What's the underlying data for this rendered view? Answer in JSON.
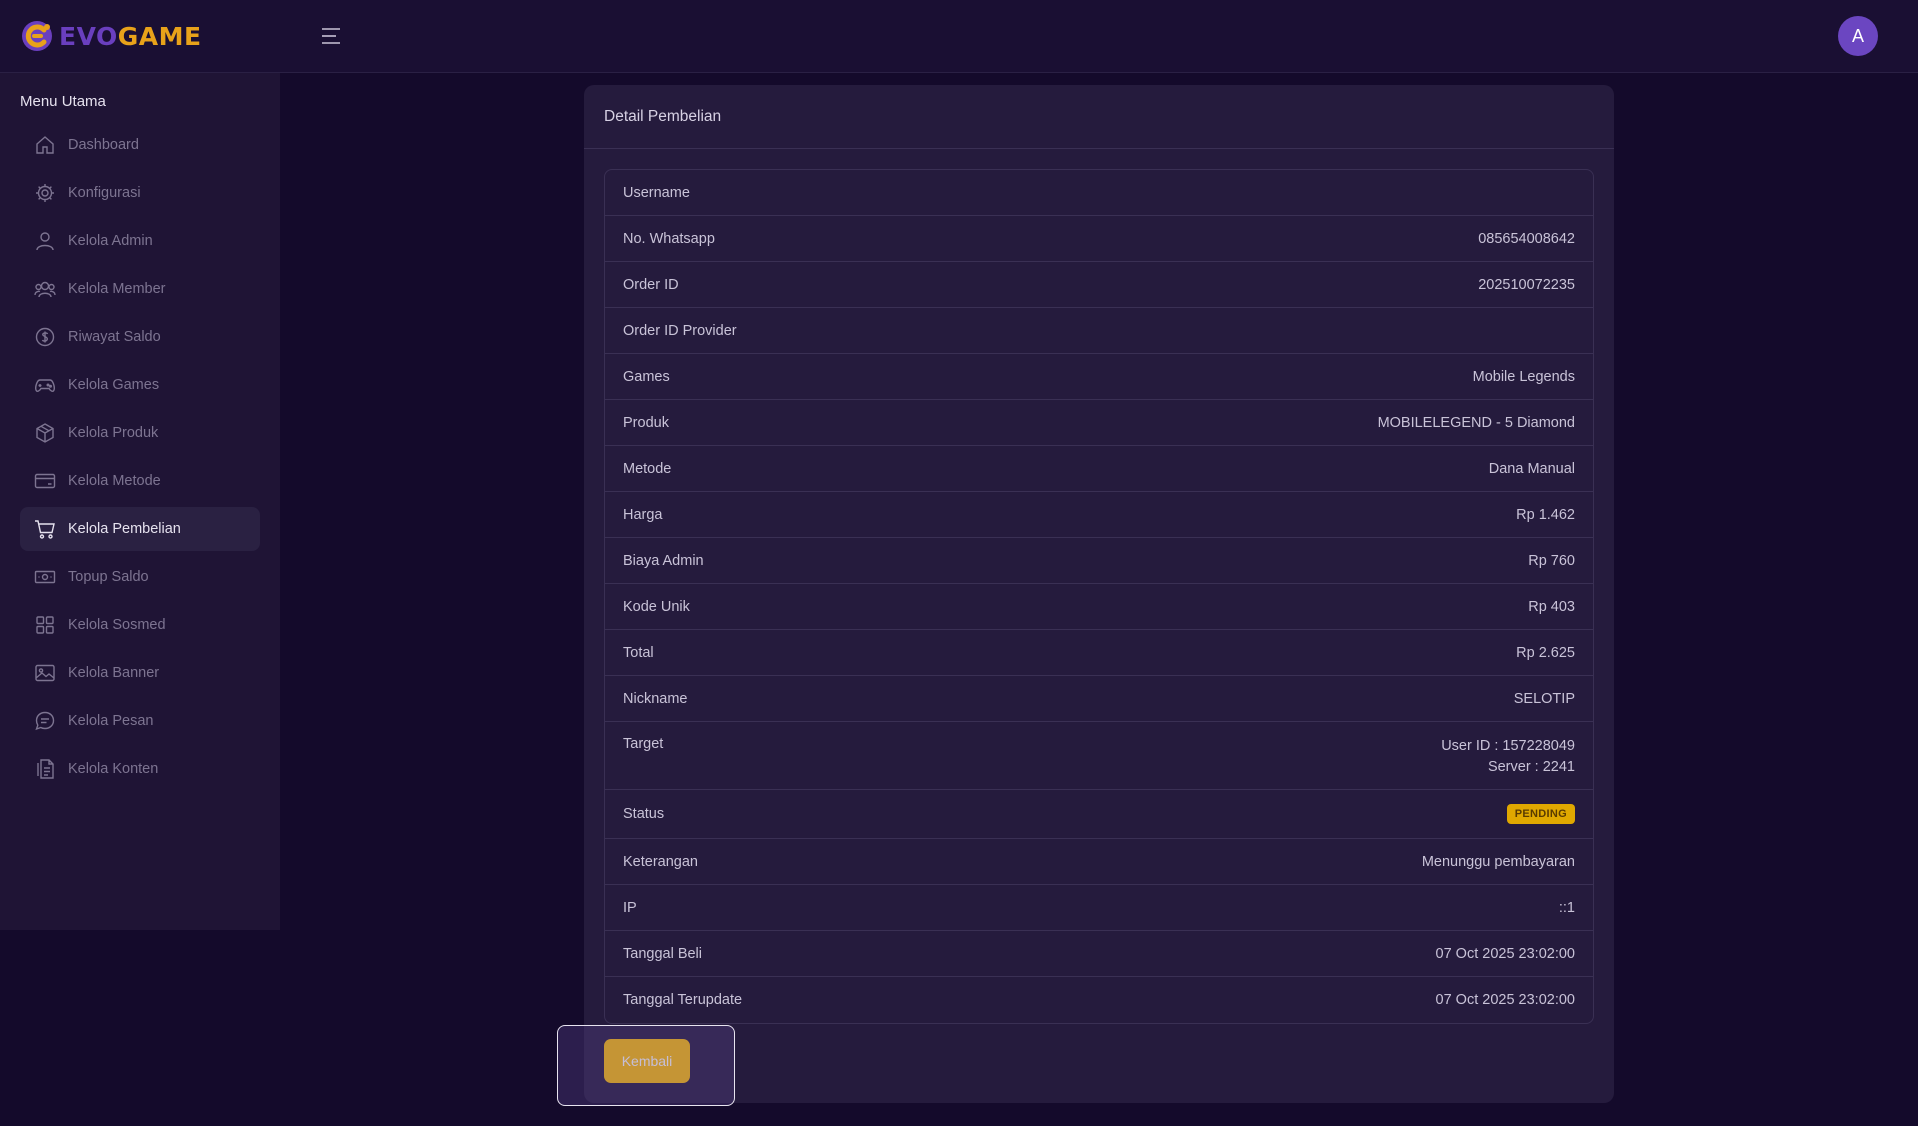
{
  "header": {
    "brand_part1": "EVO",
    "brand_part2": "GAME",
    "avatar_initial": "A",
    "colors": {
      "brand_purple": "#6a3fbf",
      "brand_orange": "#e8a21a",
      "avatar": "#6b46c1"
    }
  },
  "sidebar": {
    "heading": "Menu Utama",
    "items": [
      {
        "label": "Dashboard",
        "icon": "home-icon"
      },
      {
        "label": "Konfigurasi",
        "icon": "gear-icon"
      },
      {
        "label": "Kelola Admin",
        "icon": "user-icon"
      },
      {
        "label": "Kelola Member",
        "icon": "users-icon"
      },
      {
        "label": "Riwayat Saldo",
        "icon": "dollar-circle-icon"
      },
      {
        "label": "Kelola Games",
        "icon": "gamepad-icon"
      },
      {
        "label": "Kelola Produk",
        "icon": "box-icon"
      },
      {
        "label": "Kelola Metode",
        "icon": "credit-card-icon"
      },
      {
        "label": "Kelola Pembelian",
        "icon": "cart-icon",
        "active": true
      },
      {
        "label": "Topup Saldo",
        "icon": "cash-icon"
      },
      {
        "label": "Kelola Sosmed",
        "icon": "grid-icon"
      },
      {
        "label": "Kelola Banner",
        "icon": "image-icon"
      },
      {
        "label": "Kelola Pesan",
        "icon": "chat-icon"
      },
      {
        "label": "Kelola Konten",
        "icon": "document-icon"
      }
    ]
  },
  "card": {
    "title": "Detail Pembelian",
    "rows": [
      {
        "key": "Username",
        "value": ""
      },
      {
        "key": "No. Whatsapp",
        "value": "085654008642"
      },
      {
        "key": "Order ID",
        "value": "202510072235"
      },
      {
        "key": "Order ID Provider",
        "value": ""
      },
      {
        "key": "Games",
        "value": "Mobile Legends"
      },
      {
        "key": "Produk",
        "value": "MOBILELEGEND - 5 Diamond"
      },
      {
        "key": "Metode",
        "value": "Dana Manual"
      },
      {
        "key": "Harga",
        "value": "Rp 1.462"
      },
      {
        "key": "Biaya Admin",
        "value": "Rp 760"
      },
      {
        "key": "Kode Unik",
        "value": "Rp 403"
      },
      {
        "key": "Total",
        "value": "Rp 2.625"
      },
      {
        "key": "Nickname",
        "value": "SELOTIP"
      }
    ],
    "target": {
      "key": "Target",
      "line1": "User ID : 157228049",
      "line2": "Server : 2241"
    },
    "status": {
      "key": "Status",
      "badge": "PENDING",
      "badge_color": "#e0a800"
    },
    "rows_after": [
      {
        "key": "Keterangan",
        "value": "Menunggu pembayaran"
      },
      {
        "key": "IP",
        "value": "::1"
      },
      {
        "key": "Tanggal Beli",
        "value": "07 Oct 2025 23:02:00"
      },
      {
        "key": "Tanggal Terupdate",
        "value": "07 Oct 2025 23:02:00"
      }
    ],
    "back_button": "Kembali",
    "back_button_color": "#ffc107"
  }
}
